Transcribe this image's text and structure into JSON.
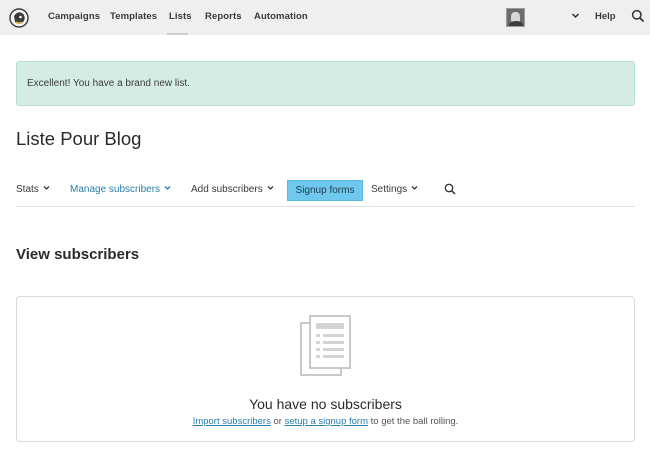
{
  "topnav": {
    "items": [
      {
        "label": "Campaigns"
      },
      {
        "label": "Templates"
      },
      {
        "label": "Lists"
      },
      {
        "label": "Reports"
      },
      {
        "label": "Automation"
      }
    ],
    "active": "Lists",
    "help_label": "Help",
    "icons": {
      "logo": "mailchimp-logo",
      "search": "search-icon",
      "account": "chevron-down-icon"
    }
  },
  "alert": {
    "text": "Excellent! You have a brand new list."
  },
  "page": {
    "title": "Liste Pour Blog"
  },
  "subnav": {
    "stats": "Stats",
    "manage": "Manage subscribers",
    "add": "Add subscribers",
    "signup": "Signup forms",
    "settings": "Settings"
  },
  "section": {
    "title": "View subscribers"
  },
  "empty": {
    "title": "You have no subscribers",
    "link_import": "Import subscribers",
    "or": "or",
    "link_signup": "setup a signup form",
    "suffix": "to get the ball rolling."
  },
  "colors": {
    "accent": "#6fc8ee",
    "link": "#2a7eab",
    "alert_bg": "#d5ece5"
  }
}
